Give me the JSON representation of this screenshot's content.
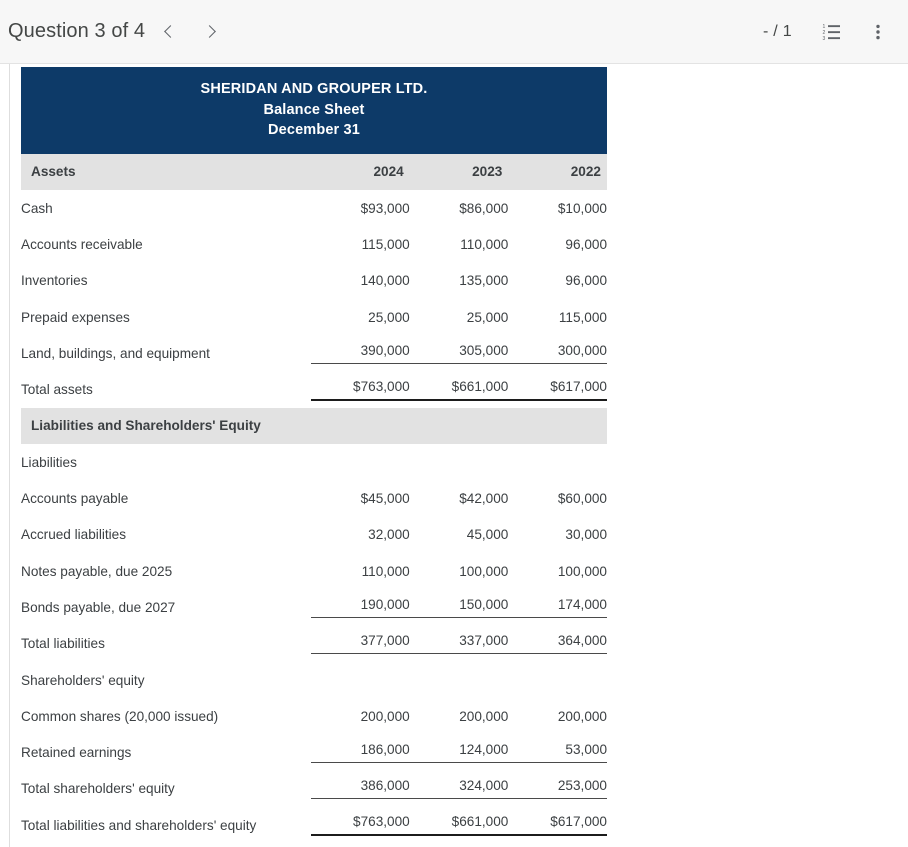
{
  "toolbar": {
    "question_label": "Question 3 of 4",
    "prev_label": "‹",
    "next_label": "›",
    "page_counter": "- / 1",
    "outline_icon": "numbered-list-icon",
    "more_icon": "more-vertical-icon",
    "background": "#f7f7f7"
  },
  "document": {
    "title_block": {
      "company": "SHERIDAN AND GROUPER LTD.",
      "statement": "Balance Sheet",
      "period": "December 31",
      "background": "#0d3a68",
      "text_color": "#ffffff"
    },
    "banner_background": "#e2e2e2",
    "columns": [
      "2024",
      "2023",
      "2022"
    ],
    "sections": [
      {
        "banner": "Assets",
        "banner_cols": [
          "2024",
          "2023",
          "2022"
        ],
        "rows": [
          {
            "label": "Cash",
            "indent": 1,
            "rule": "none",
            "values": [
              "$93,000",
              "$86,000",
              "$10,000"
            ]
          },
          {
            "label": "Accounts receivable",
            "indent": 1,
            "rule": "none",
            "values": [
              "115,000",
              "110,000",
              "96,000"
            ]
          },
          {
            "label": "Inventories",
            "indent": 1,
            "rule": "none",
            "values": [
              "140,000",
              "135,000",
              "96,000"
            ]
          },
          {
            "label": "Prepaid expenses",
            "indent": 1,
            "rule": "none",
            "values": [
              "25,000",
              "25,000",
              "115,000"
            ]
          },
          {
            "label": "Land, buildings, and equipment",
            "indent": 1,
            "rule": "thin",
            "values": [
              "390,000",
              "305,000",
              "300,000"
            ]
          },
          {
            "label": "Total assets",
            "indent": 3,
            "rule": "thick",
            "values": [
              "$763,000",
              "$661,000",
              "$617,000"
            ]
          }
        ]
      },
      {
        "banner": "Liabilities and Shareholders' Equity",
        "banner_cols": [
          "",
          "",
          ""
        ],
        "rows": [
          {
            "label": "Liabilities",
            "indent": 0,
            "rule": "none",
            "values": [
              "",
              "",
              ""
            ]
          },
          {
            "label": "Accounts payable",
            "indent": 2,
            "rule": "none",
            "values": [
              "$45,000",
              "$42,000",
              "$60,000"
            ]
          },
          {
            "label": "Accrued liabilities",
            "indent": 2,
            "rule": "none",
            "values": [
              "32,000",
              "45,000",
              "30,000"
            ]
          },
          {
            "label": "Notes payable, due 2025",
            "indent": 2,
            "rule": "none",
            "values": [
              "110,000",
              "100,000",
              "100,000"
            ]
          },
          {
            "label": "Bonds payable, due 2027",
            "indent": 2,
            "rule": "thin",
            "values": [
              "190,000",
              "150,000",
              "174,000"
            ]
          },
          {
            "label": "Total liabilities",
            "indent": 3,
            "rule": "thin",
            "values": [
              "377,000",
              "337,000",
              "364,000"
            ]
          },
          {
            "label": "Shareholders' equity",
            "indent": 0,
            "rule": "none",
            "values": [
              "",
              "",
              ""
            ]
          },
          {
            "label": "Common shares (20,000 issued)",
            "indent": 2,
            "rule": "none",
            "values": [
              "200,000",
              "200,000",
              "200,000"
            ]
          },
          {
            "label": "Retained earnings",
            "indent": 2,
            "rule": "thin",
            "values": [
              "186,000",
              "124,000",
              "53,000"
            ]
          },
          {
            "label": "Total shareholders' equity",
            "indent": 3,
            "rule": "thin",
            "values": [
              "386,000",
              "324,000",
              "253,000"
            ]
          },
          {
            "label": "Total liabilities and shareholders' equity",
            "indent": 1,
            "rule": "thick",
            "values": [
              "$763,000",
              "$661,000",
              "$617,000"
            ]
          }
        ]
      }
    ]
  }
}
